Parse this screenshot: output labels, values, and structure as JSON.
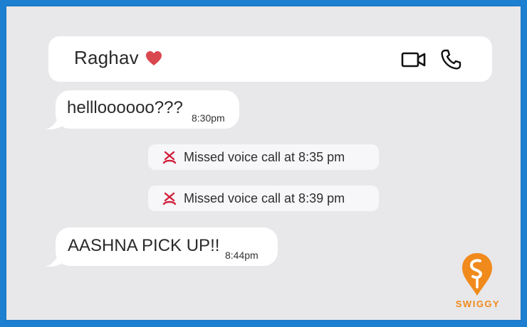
{
  "chat": {
    "contact_name": "Raghav",
    "icons": {
      "heart": "heart-icon",
      "video": "video-call-icon",
      "phone": "voice-call-icon",
      "missed_call": "missed-call-icon"
    },
    "messages": [
      {
        "text": "hellloooooo???",
        "time": "8:30pm"
      },
      {
        "text": "AASHNA PICK UP!!",
        "time": "8:44pm"
      }
    ],
    "missed_calls": [
      {
        "text": "Missed voice call at 8:35 pm"
      },
      {
        "text": "Missed voice call at 8:39 pm"
      }
    ]
  },
  "brand": {
    "name": "SWIGGY",
    "color": "#f08a1c"
  },
  "colors": {
    "background": "#1c7fd0",
    "panel": "#e8e7ea",
    "heart": "#d9474f",
    "missed_call": "#d11f3a"
  }
}
